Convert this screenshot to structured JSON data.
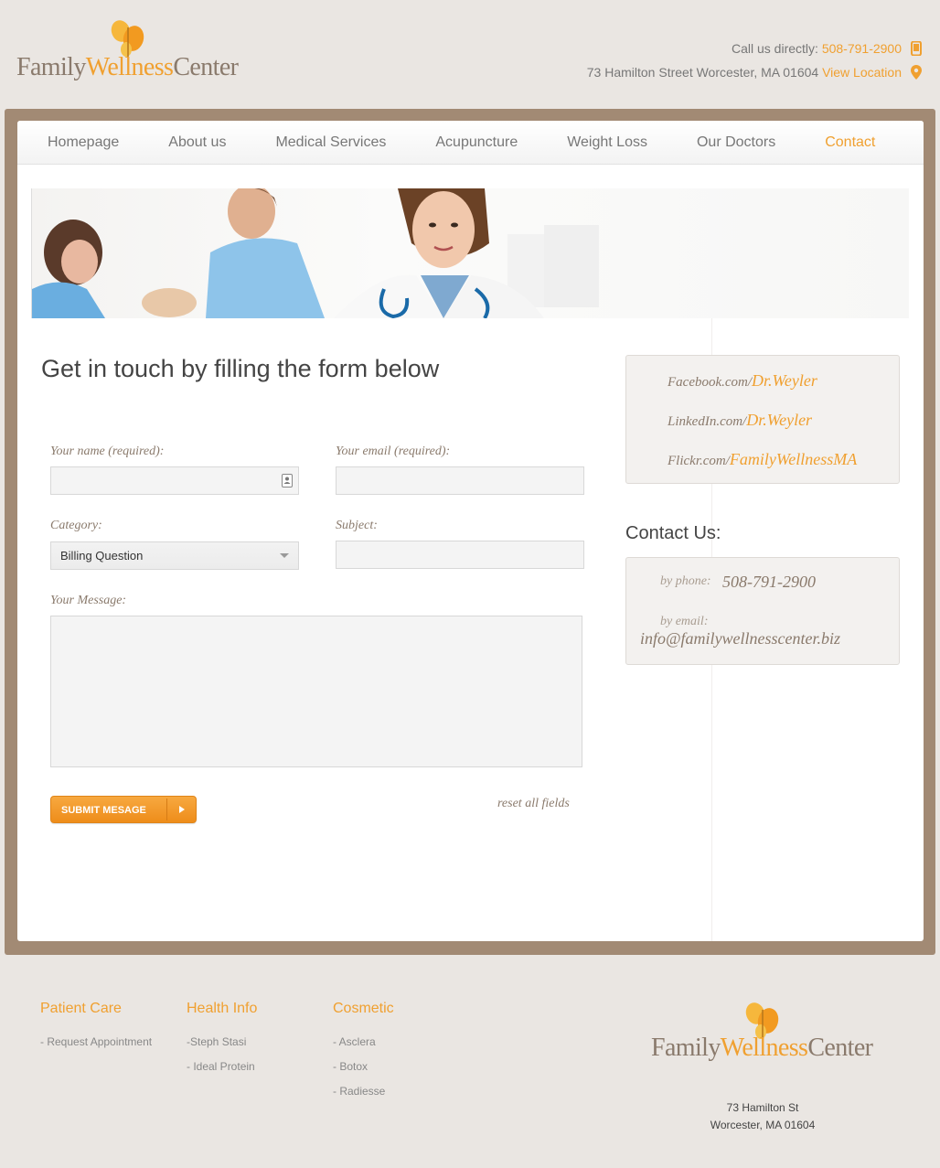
{
  "brand": {
    "family": "Family",
    "wellness": "Wellness",
    "center": "Center"
  },
  "header": {
    "call_label": "Call us directly:",
    "phone": "508-791-2900",
    "address": "73 Hamilton Street Worcester, MA 01604",
    "view_location": "View Location"
  },
  "nav": [
    {
      "label": "Homepage"
    },
    {
      "label": "About us"
    },
    {
      "label": "Medical Services"
    },
    {
      "label": "Acupuncture"
    },
    {
      "label": "Weight Loss"
    },
    {
      "label": "Our Doctors"
    },
    {
      "label": "Contact"
    }
  ],
  "form": {
    "title": "Get in touch by filling the form below",
    "name_label": "Your name (required):",
    "email_label": "Your email (required):",
    "category_label": "Category:",
    "category_value": "Billing Question",
    "subject_label": "Subject:",
    "message_label": "Your Message:",
    "submit_label": "SUBMIT MESAGE",
    "reset_label": "reset all fields"
  },
  "social": [
    {
      "prefix": "Facebook.com/",
      "handle": "Dr.Weyler"
    },
    {
      "prefix": "LinkedIn.com/",
      "handle": "Dr.Weyler"
    },
    {
      "prefix": "Flickr.com/",
      "handle": "FamilyWellnessMA"
    }
  ],
  "contact": {
    "heading": "Contact Us:",
    "phone_label": "by phone:",
    "phone": "508-791-2900",
    "email_label": "by email:",
    "email": "info@familywellnesscenter.biz"
  },
  "footer": {
    "columns": [
      {
        "heading": "Patient Care",
        "items": [
          "- Request Appointment"
        ]
      },
      {
        "heading": "Health Info",
        "items": [
          "-Steph Stasi",
          "- Ideal Protein"
        ]
      },
      {
        "heading": "Cosmetic",
        "items": [
          "- Asclera",
          "- Botox",
          "- Radiesse"
        ]
      }
    ],
    "address_line1": "73 Hamilton St",
    "address_line2": "Worcester, MA 01604"
  },
  "colors": {
    "accent": "#f0a030",
    "frame": "#a28a74",
    "page_bg": "#eae6e2"
  }
}
